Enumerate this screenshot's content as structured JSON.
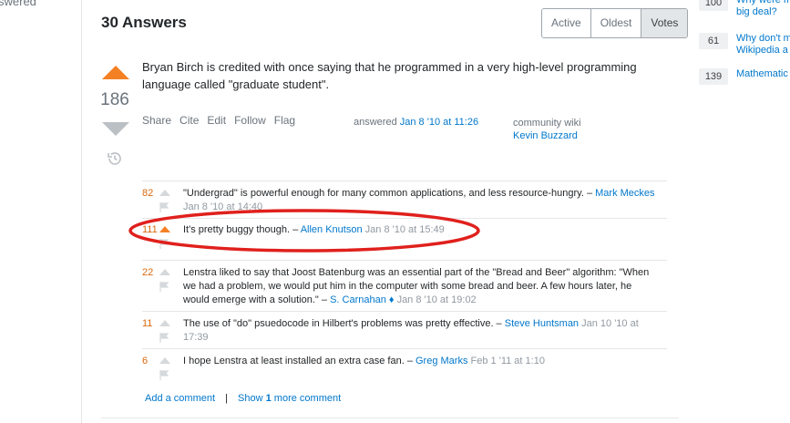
{
  "left_nav": {
    "cut_text": "swered"
  },
  "answers": {
    "title": "30 Answers",
    "sort_tabs": [
      "Active",
      "Oldest",
      "Votes"
    ],
    "active_sort": "Votes"
  },
  "answer": {
    "vote_count": "186",
    "body": "Bryan Birch is credited with once saying that he programmed in a very high-level programming language called \"graduate student\".",
    "menu": [
      "Share",
      "Cite",
      "Edit",
      "Follow",
      "Flag"
    ],
    "answered_label": "answered",
    "answered_time": "Jan 8 '10 at 11:26",
    "community_wiki": "community wiki",
    "author": "Kevin Buzzard"
  },
  "comments": [
    {
      "score": "82",
      "text": "\"Undergrad\" is powerful enough for many common applications, and less resource-hungry.",
      "dash": " –",
      "user": "Mark Meckes",
      "date": "Jan 8 '10 at 14:40",
      "voted": false
    },
    {
      "score": "111",
      "text": "It's pretty buggy though.",
      "dash": " – ",
      "user": "Allen Knutson",
      "date": "Jan 8 '10 at 15:49",
      "voted": true
    },
    {
      "score": "22",
      "text": "Lenstra liked to say that Joost Batenburg was an essential part of the \"Bread and Beer\" algorithm: \"When we had a problem, we would put him in the computer with some bread and beer. A few hours later, he would emerge with a solution.\"",
      "dash": " – ",
      "user": "S. Carnahan ♦",
      "date": "Jan 8 '10 at 19:02",
      "voted": false
    },
    {
      "score": "11",
      "text": "The use of \"do\" psuedocode in Hilbert's problems was pretty effective.",
      "dash": " – ",
      "user": "Steve Huntsman",
      "date": "Jan 10 '10 at 17:39",
      "voted": false
    },
    {
      "score": "6",
      "text": "I hope Lenstra at least installed an extra case fan.",
      "dash": " – ",
      "user": "Greg Marks",
      "date": "Feb 1 '11 at 1:10",
      "voted": false
    }
  ],
  "comment_actions": {
    "add": "Add a comment",
    "separator": "|",
    "show_prefix": "Show ",
    "show_count": "1",
    "show_suffix": " more comment"
  },
  "hot_network": [
    {
      "score": "100",
      "title": "Why were m big deal?"
    },
    {
      "score": "61",
      "title": "Why don't m Wikipedia a"
    },
    {
      "score": "139",
      "title": "Mathematic"
    }
  ],
  "colors": {
    "accent": "#f48024",
    "link": "#0077cc",
    "annotation": "#e0201c"
  }
}
